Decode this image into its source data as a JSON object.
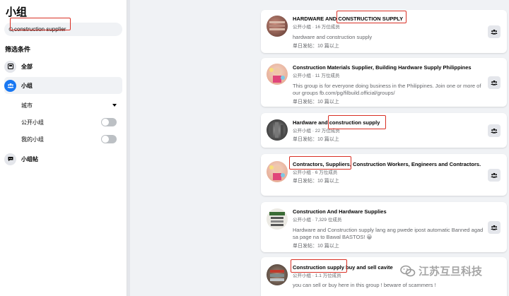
{
  "sidebar": {
    "title": "小组",
    "search": {
      "value": "construction supplier",
      "placeholder": "搜索小组"
    },
    "filters_title": "筛选条件",
    "nav": {
      "all": "全部",
      "groups": "小组",
      "posts": "小组帖"
    },
    "sub": {
      "city": "城市",
      "public": "公开小组",
      "mine": "我的小组"
    }
  },
  "results": [
    {
      "title_pre": "HARDWARE AND ",
      "title_hl": "CONSTRUCTION SUPPLY",
      "title_post": "",
      "meta": "公开小组 · 16 万位成员",
      "desc": "hardware and construction supply",
      "posts": "单日发帖：10 篇以上"
    },
    {
      "title_pre": "Construction Materials Supplier, Building Hardware Supply Philippines",
      "title_hl": "",
      "title_post": "",
      "meta": "公开小组 · 11 万位成员",
      "desc": "This group is for everyone doing business in the Philippines. Join one or more of our groups fb.com/pg/filbuild.official/groups/",
      "posts": "单日发帖：10 篇以上"
    },
    {
      "title_pre": "Hardware and ",
      "title_hl": "construction supply",
      "title_post": "",
      "meta": "公开小组 · 22 万位成员",
      "desc": "",
      "posts": "单日发帖：10 篇以上"
    },
    {
      "title_pre": "",
      "title_hl": "Contractors, Suppliers",
      "title_post": ", Construction Workers, Engineers and Contractors.",
      "meta": "公开小组 · 6 万位成员",
      "desc": "",
      "posts": "单日发帖：10 篇以上"
    },
    {
      "title_pre": "Construction And Hardware Supplies",
      "title_hl": "",
      "title_post": "",
      "meta": "公开小组 · 7,329 位成员",
      "desc": "Hardware and Construction supply lang ang pwede ipost automatic Banned agad sa page na to Bawal BASTOS! 😀",
      "posts": "单日发帖：10 篇以上"
    },
    {
      "title_pre": "",
      "title_hl": "Construction supply",
      "title_post": " buy and sell cavite",
      "meta": "公开小组 · 1.1 万位成员",
      "desc": "you can sell or buy here in this group ! beware of scammers !",
      "posts": "单日发帖：10 篇以上"
    }
  ],
  "watermark": "江苏互旦科技",
  "colors": {
    "accent": "#1877f2",
    "highlight": "#d93025",
    "muted": "#65676b"
  }
}
